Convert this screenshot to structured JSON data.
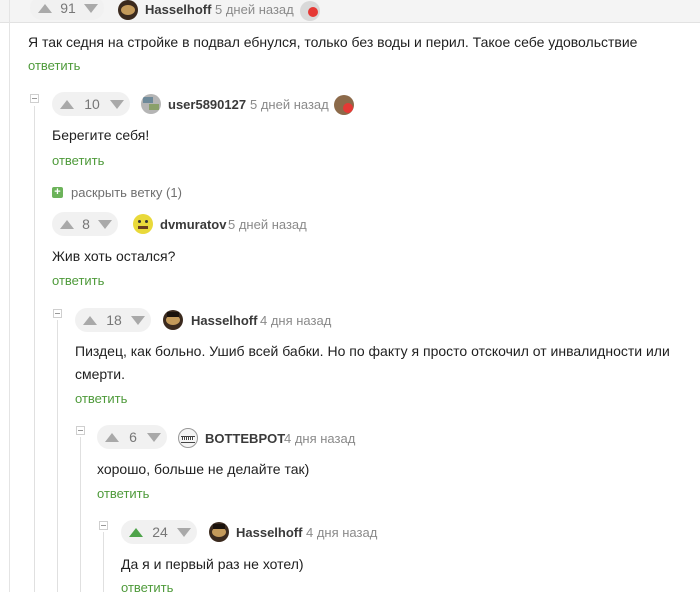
{
  "top_comment": {
    "rating": "91",
    "user": "Hasselhoff",
    "time": "5 дней назад",
    "text": "Я так седня на стройке в подвал ебнулся, только без воды и перил. Такое себе удовольствие",
    "reply": "ответить"
  },
  "comments": [
    {
      "rating": "10",
      "user": "user5890127",
      "time": "5 дней назад",
      "text": "Берегите себя!",
      "reply": "ответить",
      "upvoted": false
    },
    {
      "rating": "8",
      "user": "dvmuratov",
      "time": "5 дней назад",
      "text": "Жив хоть остался?",
      "reply": "ответить",
      "upvoted": false
    },
    {
      "rating": "18",
      "user": "Hasselhoff",
      "time": "4 дня назад",
      "text": "Пиздец, как больно. Ушиб всей бабки. Но по факту я просто отскочил от инвалидности или смерти.",
      "reply": "ответить",
      "upvoted": false
    },
    {
      "rating": "6",
      "user": "BOTTEBPOT",
      "time": "4 дня назад",
      "text": "хорошо, больше не делайте так)",
      "reply": "ответить",
      "upvoted": false
    },
    {
      "rating": "24",
      "user": "Hasselhoff",
      "time": "4 дня назад",
      "text": "Да я и первый раз не хотел)",
      "reply": "ответить",
      "upvoted": true
    }
  ],
  "expand_branch": {
    "label": "раскрыть ветку (1)",
    "icon": "plus-icon"
  },
  "colors": {
    "accent_green": "#4e9a3a",
    "vote_bg": "#f1f1f1"
  }
}
